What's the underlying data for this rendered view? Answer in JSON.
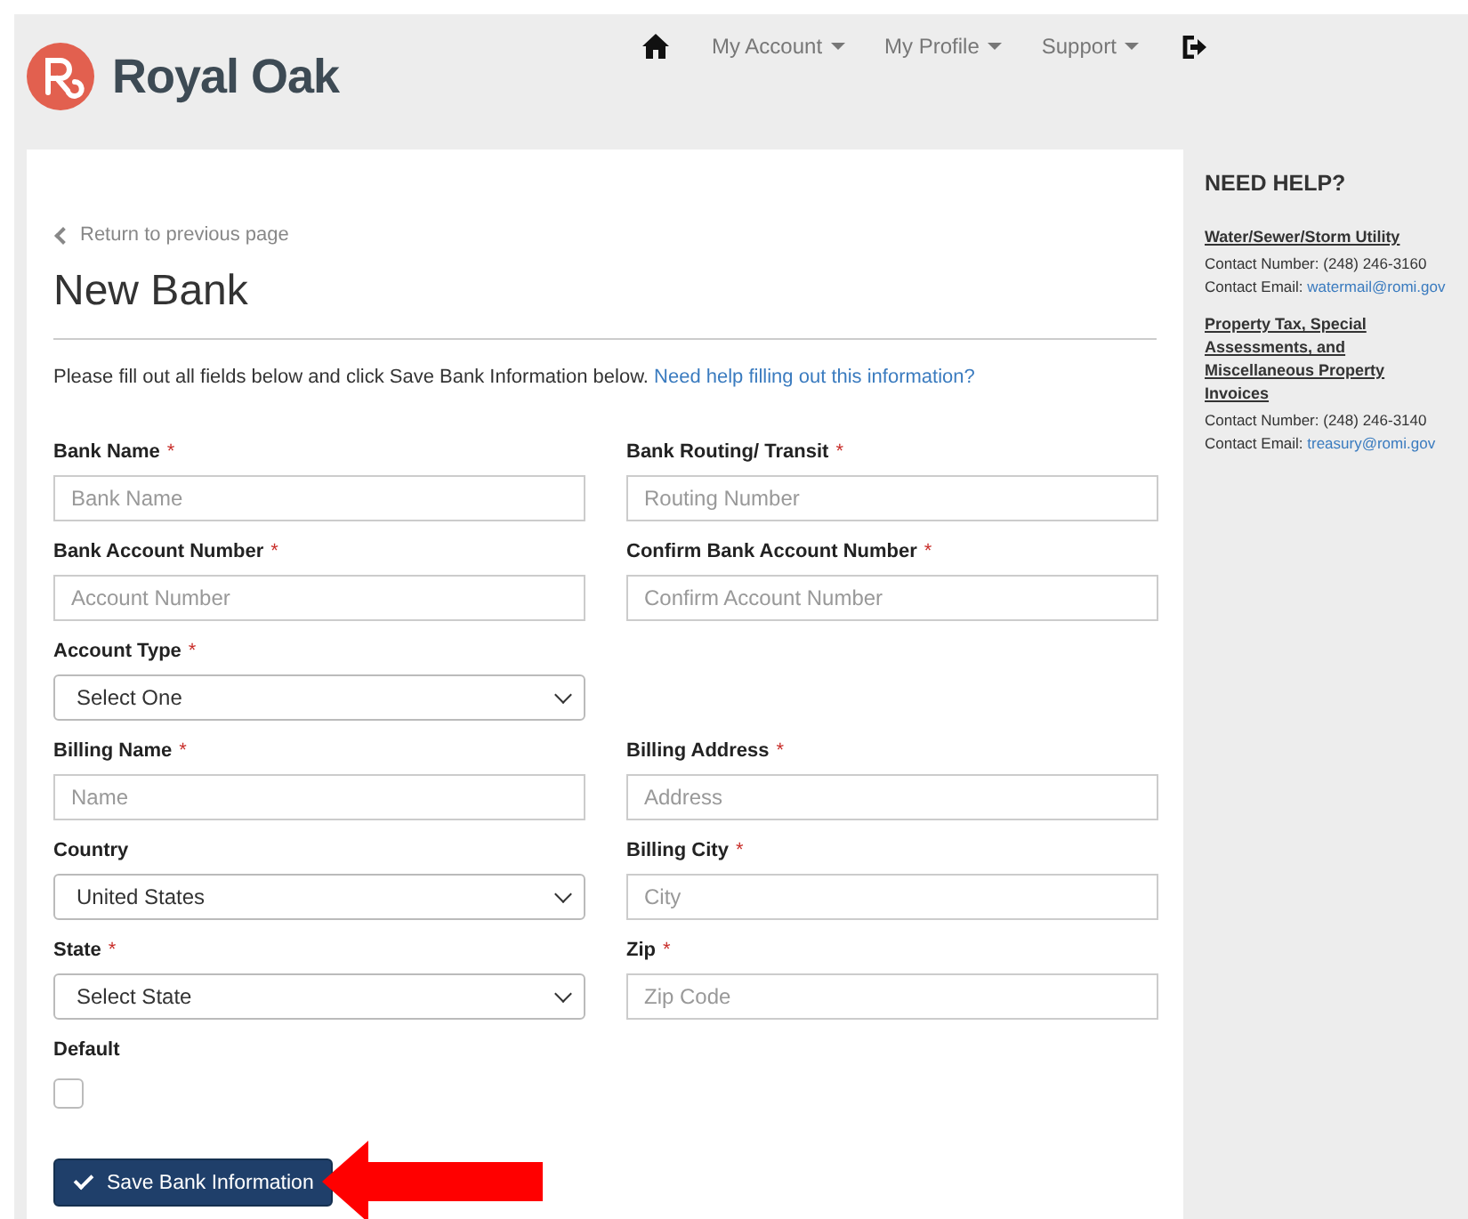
{
  "header": {
    "logo_text": "Royal Oak",
    "nav": [
      {
        "kind": "home"
      },
      {
        "kind": "menu",
        "label": "My Account"
      },
      {
        "kind": "menu",
        "label": "My Profile"
      },
      {
        "kind": "menu",
        "label": "Support"
      },
      {
        "kind": "logout"
      }
    ]
  },
  "back_link": "Return to previous page",
  "title": "New Bank",
  "instructions": {
    "text": "Please fill out all fields below and click Save Bank Information below.",
    "link": "Need help filling out this information?"
  },
  "form_rows": [
    [
      {
        "label": "Bank Name",
        "required": true,
        "kind": "text",
        "placeholder": "Bank Name"
      },
      {
        "label": "Bank Routing/ Transit",
        "required": true,
        "kind": "text",
        "placeholder": "Routing Number"
      }
    ],
    [
      {
        "label": "Bank Account Number",
        "required": true,
        "kind": "text",
        "placeholder": "Account Number"
      },
      {
        "label": "Confirm Bank Account Number",
        "required": true,
        "kind": "text",
        "placeholder": "Confirm Account Number"
      }
    ],
    [
      {
        "label": "Account Type",
        "required": true,
        "kind": "select",
        "value": "Select One"
      }
    ],
    [
      {
        "label": "Billing Name",
        "required": true,
        "kind": "text",
        "placeholder": "Name"
      },
      {
        "label": "Billing Address",
        "required": true,
        "kind": "text",
        "placeholder": "Address"
      }
    ],
    [
      {
        "label": "Country",
        "required": false,
        "kind": "select",
        "value": "United States"
      },
      {
        "label": "Billing City",
        "required": true,
        "kind": "text",
        "placeholder": "City"
      }
    ],
    [
      {
        "label": "State",
        "required": true,
        "kind": "select",
        "value": "Select State"
      },
      {
        "label": "Zip",
        "required": true,
        "kind": "text",
        "placeholder": "Zip Code"
      }
    ],
    [
      {
        "label": "Default",
        "required": false,
        "kind": "checkbox",
        "checked": false
      }
    ]
  ],
  "required_mark": "*",
  "save_button": "Save Bank Information",
  "sidebar": {
    "title": "NEED HELP?",
    "contacts": [
      {
        "name": "Water/Sewer/Storm Utility",
        "number_label": "Contact Number:",
        "number": "(248) 246-3160",
        "email_label": "Contact Email:",
        "email": "watermail@romi.gov"
      },
      {
        "name": "Property Tax, Special Assessments, and Miscellaneous Property Invoices",
        "number_label": "Contact Number:",
        "number": "(248) 246-3140",
        "email_label": "Contact Email:",
        "email": "treasury@romi.gov"
      }
    ]
  }
}
